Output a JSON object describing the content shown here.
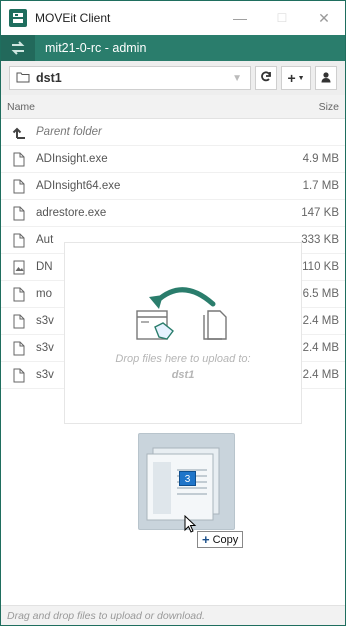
{
  "window": {
    "title": "MOVEit Client",
    "minimize_glyph": "—",
    "maximize_glyph": "☐",
    "close_glyph": "✕"
  },
  "connection": {
    "title": "mit21-0-rc - admin",
    "switch_icon": "swap-arrows-icon"
  },
  "folder_bar": {
    "current_folder": "dst1",
    "refresh_icon": "refresh-icon",
    "new_icon": "plus-icon",
    "user_icon": "user-icon"
  },
  "list_header": {
    "name": "Name",
    "size": "Size"
  },
  "files": [
    {
      "name": "Parent folder",
      "size": "",
      "icon": "parent-folder-icon",
      "italic": true
    },
    {
      "name": "ADInsight.exe",
      "size": "4.9 MB",
      "icon": "file-icon"
    },
    {
      "name": "ADInsight64.exe",
      "size": "1.7 MB",
      "icon": "file-icon"
    },
    {
      "name": "adrestore.exe",
      "size": "147 KB",
      "icon": "file-icon"
    },
    {
      "name": "Aut",
      "size": "333 KB",
      "icon": "file-icon"
    },
    {
      "name": "DN",
      "size": "110 KB",
      "icon": "image-file-icon"
    },
    {
      "name": "mo",
      "size": "6.5 MB",
      "icon": "file-icon"
    },
    {
      "name": "s3v",
      "size": "2.4 MB",
      "icon": "file-icon"
    },
    {
      "name": "s3v",
      "size": "2.4 MB",
      "icon": "file-icon"
    },
    {
      "name": "s3v",
      "size": "2.4 MB",
      "icon": "file-icon"
    }
  ],
  "dropzone": {
    "text": "Drop files here to upload to:",
    "folder": "dst1"
  },
  "drag": {
    "count": "3",
    "tooltip": "Copy"
  },
  "status": {
    "text": "Drag and drop files to upload or download."
  },
  "colors": {
    "accent": "#2a7d6c",
    "accent_dark": "#22695b",
    "drag_badge": "#1f75c9"
  }
}
